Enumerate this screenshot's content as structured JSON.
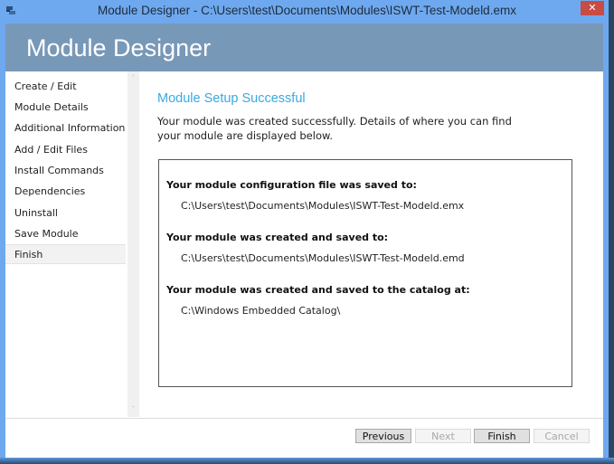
{
  "window": {
    "title": "Module Designer - C:\\Users\\test\\Documents\\Modules\\ISWT-Test-Modeld.emx",
    "close_glyph": "✕",
    "app_icon": "module-designer-icon"
  },
  "header": {
    "title": "Module Designer"
  },
  "sidebar": {
    "items": [
      {
        "label": "Create / Edit"
      },
      {
        "label": "Module Details"
      },
      {
        "label": "Additional Information"
      },
      {
        "label": "Add / Edit Files"
      },
      {
        "label": "Install Commands"
      },
      {
        "label": "Dependencies"
      },
      {
        "label": "Uninstall"
      },
      {
        "label": "Save Module"
      },
      {
        "label": "Finish"
      }
    ],
    "active_index": 8,
    "scroll_up_glyph": "˄",
    "scroll_down_glyph": "˅"
  },
  "main": {
    "heading": "Module Setup Successful",
    "intro": "Your module was created successfully. Details of where you can find your module are displayed below.",
    "details": [
      {
        "label": "Your module configuration file was saved to:",
        "value": "C:\\Users\\test\\Documents\\Modules\\ISWT-Test-Modeld.emx"
      },
      {
        "label": "Your module was created and saved to:",
        "value": "C:\\Users\\test\\Documents\\Modules\\ISWT-Test-Modeld.emd"
      },
      {
        "label": "Your module was created and saved to the catalog at:",
        "value": "C:\\Windows Embedded Catalog\\"
      }
    ]
  },
  "footer": {
    "previous": "Previous",
    "next": "Next",
    "finish": "Finish",
    "cancel": "Cancel"
  },
  "colors": {
    "accent": "#39a9e0",
    "header_bg": "#7898b8",
    "window_frame": "#6ea9ef",
    "close_button": "#c74c44"
  }
}
